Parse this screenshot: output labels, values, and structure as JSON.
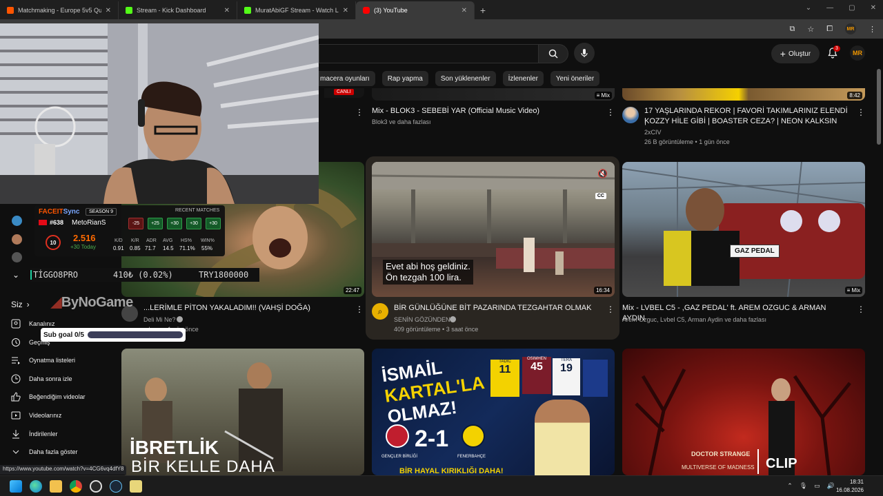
{
  "browser": {
    "tabs": [
      {
        "title": "Matchmaking - Europe 5v5 Qu",
        "icon": "faceit-icon",
        "color": "#ff5500",
        "active": false
      },
      {
        "title": "Stream - Kick Dashboard",
        "icon": "kick-icon",
        "color": "#53fc18",
        "active": false
      },
      {
        "title": "MuratAbiGF Stream - Watch Li",
        "icon": "kick-icon",
        "color": "#53fc18",
        "active": false
      },
      {
        "title": "(3) YouTube",
        "icon": "youtube-icon",
        "color": "#ff0000",
        "active": true
      }
    ],
    "profile_initials": "MR"
  },
  "youtube": {
    "create_label": "Oluştur",
    "notification_count": "3",
    "avatar_initials": "MR",
    "chips": [
      "macera oyunları",
      "Rap yapma",
      "Son yüklenenler",
      "İzlenenler",
      "Yeni öneriler"
    ],
    "top_row": {
      "live_badge": "CANLI",
      "mix_badge": "Mix",
      "duration_right": "8:42",
      "video1": {
        "title": "Mix - BLOK3 - SEBEBİ YAR (Official Music Video)",
        "meta": "Blok3 ve daha fazlası"
      },
      "video2": {
        "title_line1": "17 YAŞLARINDA REKOR | FAVORİ TAKIMLARINIZ ELENDİ |",
        "title_line2": "KOZZY HİLE GİBİ | BOASTER CEZA? | NEON KALKSIN",
        "channel": "2xCIV",
        "views": "26 B görüntüleme • 1 gün önce"
      }
    },
    "middle_row": {
      "left": {
        "title": "...LERİMLE PİTON YAKALADIM!! (VAHŞİ DOĞA)",
        "channel": "Deli Mi Ne?",
        "meta": "...leme • 1 gün önce",
        "duration": "22:47"
      },
      "center": {
        "title": "BİR GÜNLÜĞÜNE BİT PAZARINDA TEZGAHTAR OLMAK",
        "channel": "SENİN GÖZÜNDEN",
        "meta": "409 görüntüleme • 3 saat önce",
        "duration": "16:34",
        "caption_line1": "Evet abi hoş geldiniz.",
        "caption_line2": "Ön tezgah 100 lira.",
        "cc_label": "CC"
      },
      "right": {
        "title": "Mix - LVBEL C5 - ,GAZ PEDAL' ft. AREM OZGUC & ARMAN AYDIN",
        "meta": "Arem Ozguc, Lvbel C5, Arman Aydin ve daha fazlası",
        "mix_label": "Mix",
        "plate": "GAZ PEDAL"
      }
    },
    "bottom_row": {
      "left": {
        "overlay_line1": "İBRETLİK",
        "overlay_line2": "BİR KELLE DAHA"
      },
      "center": {
        "headline1": "İSMAİL",
        "headline2": "KARTAL'LA",
        "headline3": "OLMAZ!",
        "score": "2-1",
        "team1": "GENÇLER BİRLİĞİ",
        "team2": "FENERBAHÇE",
        "bottom_text": "BİR HAYAL KIRIKLIĞI DAHA!",
        "jersey1": "11",
        "jersey2": "45",
        "jersey3": "19",
        "jersey1_name": "TADIC",
        "jersey2_name": "OSIMHEN",
        "jersey3_name": "TERA"
      },
      "right": {
        "brand": "DOCTOR STRANGE",
        "subtitle": "MULTIVERSE OF MADNESS",
        "clip_label": "CLIP"
      }
    },
    "sidebar": {
      "section_title": "Siz",
      "items": [
        "Kanalınız",
        "Geçmiş",
        "Oynatma listeleri",
        "Daha sonra izle",
        "Beğendiğim videolar",
        "Videolarınız",
        "İndirilenler",
        "Daha fazla göster"
      ]
    }
  },
  "overlay": {
    "faceit": {
      "brand1": "FACEIT",
      "brand2": "Sync",
      "season": "SEASON 9",
      "recent": "RECENT MATCHES",
      "rank": "#638",
      "nickname": "MetoRianS",
      "level": "10",
      "elo": "2.516",
      "today": "+30 Today",
      "matches": [
        "-25",
        "+25",
        "+30",
        "+30",
        "+30"
      ],
      "stats_labels": [
        "K/D",
        "K/R",
        "ADR",
        "AVG",
        "HS%",
        "WIN%"
      ],
      "stats_values": [
        "0.91",
        "0.85",
        "71.7",
        "14.5",
        "71.1%",
        "55%"
      ]
    },
    "ticker": {
      "symbol": "TİGGO8PRO",
      "change": "410₺ (0.02%)",
      "amount": "TRY1800000"
    },
    "bynogame": "ByNoGame",
    "sub_goal": {
      "label": "Sub goal 0/5",
      "progress": 0
    }
  },
  "status_url": "https://www.youtube.com/watch?v=4CG6vq4dfY8",
  "taskbar": {
    "time": "18:31",
    "date": "16.08.2026"
  }
}
